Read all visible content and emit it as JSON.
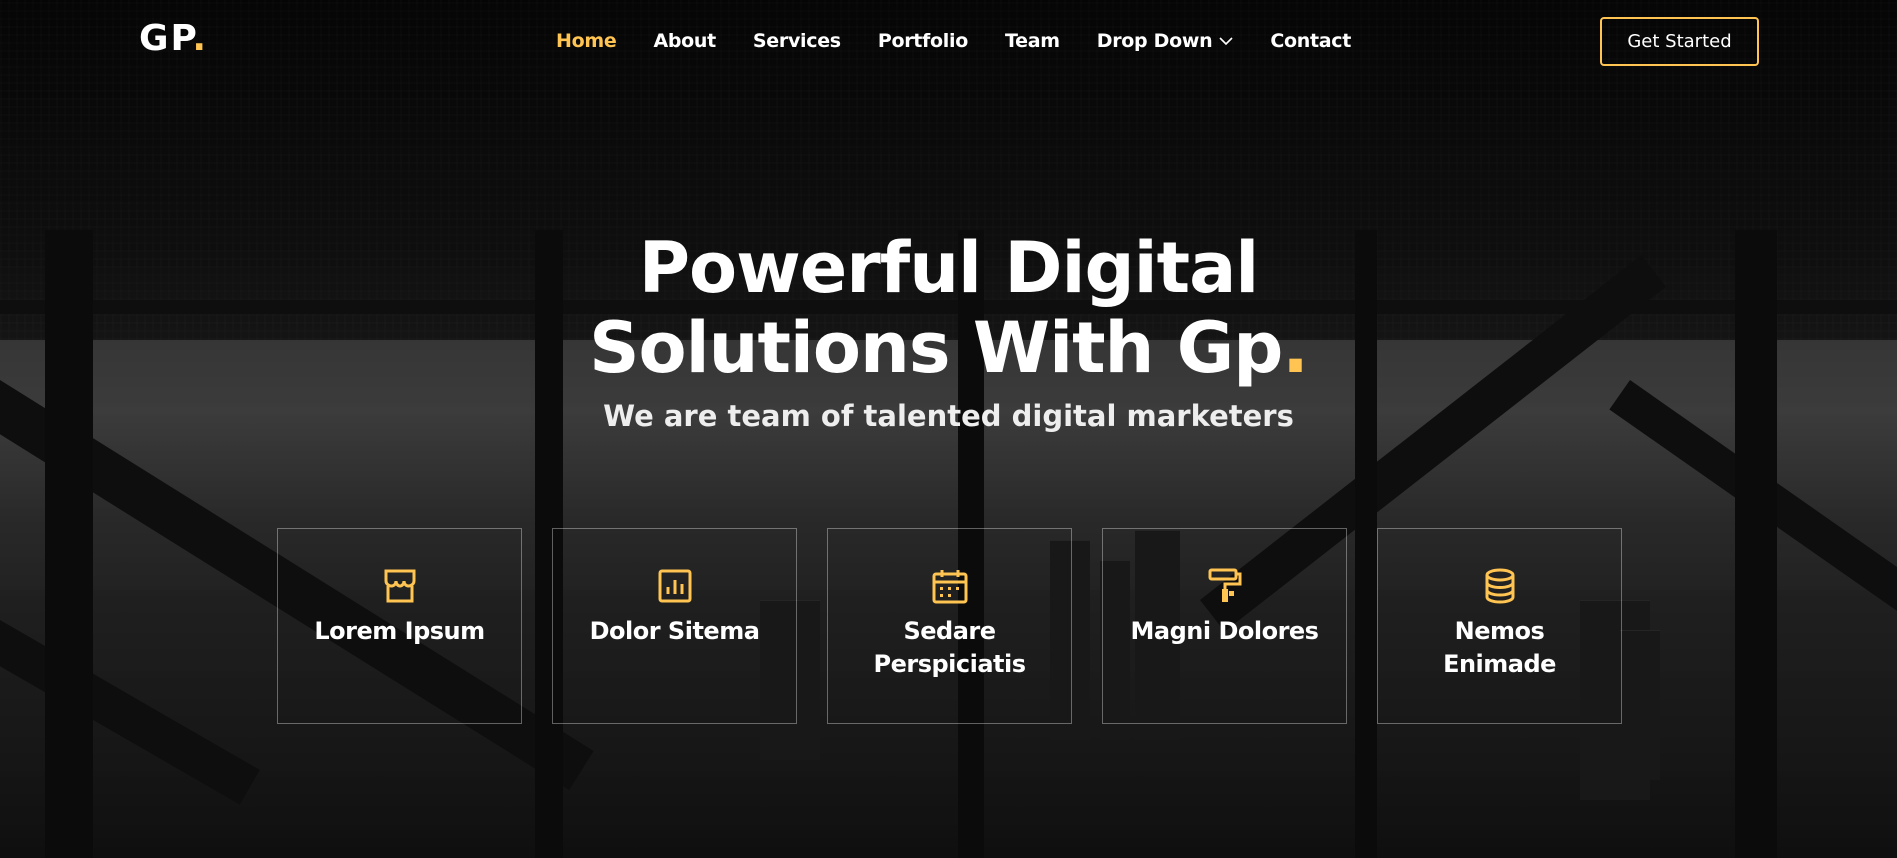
{
  "brand": {
    "logo_text": "GP",
    "logo_dot": "."
  },
  "nav": {
    "items": [
      {
        "label": "Home",
        "active": true
      },
      {
        "label": "About"
      },
      {
        "label": "Services"
      },
      {
        "label": "Portfolio"
      },
      {
        "label": "Team"
      },
      {
        "label": "Drop Down"
      },
      {
        "label": "Contact"
      }
    ],
    "cta_label": "Get Started"
  },
  "hero": {
    "title_line1": "Powerful Digital",
    "title_line2": "Solutions With Gp",
    "title_dot": ".",
    "subtitle": "We are team of talented digital marketers"
  },
  "features": [
    {
      "icon": "store-icon",
      "label": "Lorem Ipsum"
    },
    {
      "icon": "bar-chart-icon",
      "label": "Dolor Sitema"
    },
    {
      "icon": "calendar-icon",
      "label": "Sedare Perspiciatis"
    },
    {
      "icon": "paint-roller-icon",
      "label": "Magni Dolores"
    },
    {
      "icon": "database-icon",
      "label": "Nemos Enimade"
    }
  ],
  "colors": {
    "accent": "#ffc451",
    "text": "#ffffff"
  }
}
